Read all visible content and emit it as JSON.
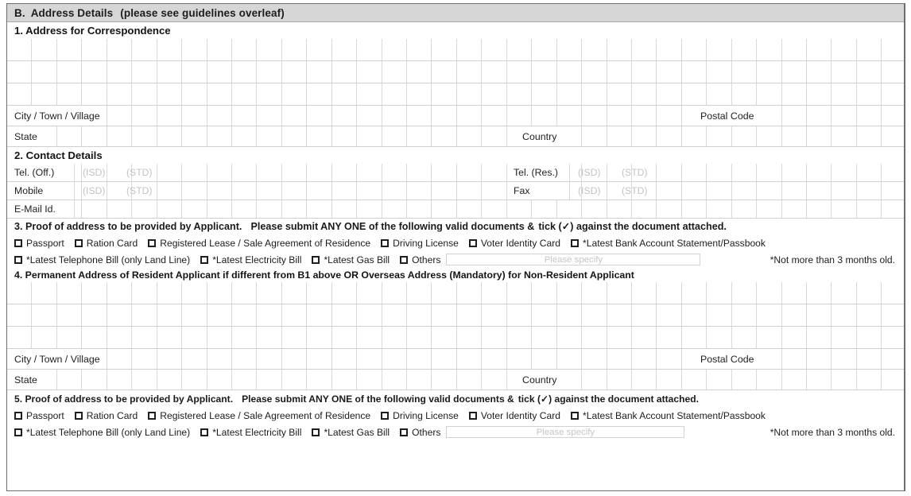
{
  "section": {
    "letter": "B.",
    "title": "Address Details",
    "subtitle": "(please see guidelines overleaf)"
  },
  "item1": {
    "heading": "1. Address for Correspondence",
    "city_label": "City / Town / Village",
    "postal_label": "Postal Code",
    "state_label": "State",
    "country_label": "Country"
  },
  "item2": {
    "heading": "2. Contact Details",
    "tel_off_label": "Tel. (Off.)",
    "tel_res_label": "Tel. (Res.)",
    "mobile_label": "Mobile",
    "fax_label": "Fax",
    "email_label": "E-Mail Id.",
    "isd_placeholder": "(ISD)",
    "std_placeholder": "(STD)"
  },
  "item3": {
    "heading_a": "3. Proof of address to be provided by Applicant.",
    "heading_b": "Please submit ANY ONE of the following valid documents &",
    "heading_c": "tick (✓) against the document attached.",
    "row1": [
      "Passport",
      "Ration Card",
      "Registered Lease / Sale Agreement of Residence",
      "Driving License",
      "Voter Identity Card",
      "*Latest Bank Account Statement/Passbook"
    ],
    "row2": [
      "*Latest Telephone Bill (only Land Line)",
      "*Latest Electricity Bill",
      "*Latest Gas Bill",
      "Others"
    ],
    "specify_placeholder": "Please specify",
    "note": "*Not more than 3 months old."
  },
  "item4": {
    "heading": "4. Permanent Address of Resident Applicant if different from B1 above OR Overseas Address (Mandatory) for Non-Resident Applicant",
    "city_label": "City / Town / Village",
    "postal_label": "Postal Code",
    "state_label": "State",
    "country_label": "Country"
  },
  "item5": {
    "heading_a": "5. Proof of address to be provided by Applicant.",
    "heading_b": "Please submit ANY ONE of the following valid documents &",
    "heading_c": "tick (✓) against the document attached.",
    "row1": [
      "Passport",
      "Ration Card",
      "Registered Lease / Sale Agreement of Residence",
      "Driving License",
      "Voter Identity Card",
      "*Latest Bank Account Statement/Passbook"
    ],
    "row2": [
      "*Latest Telephone Bill (only Land Line)",
      "*Latest Electricity Bill",
      "*Latest Gas Bill",
      "Others"
    ],
    "specify_placeholder": "Please specify",
    "note": "*Not more than 3 months old."
  },
  "colors": {
    "header_bar": "#d6d6d6",
    "border": "#6e6e6e",
    "grid_line": "#d9d9d9",
    "placeholder": "#c3c3c3"
  }
}
